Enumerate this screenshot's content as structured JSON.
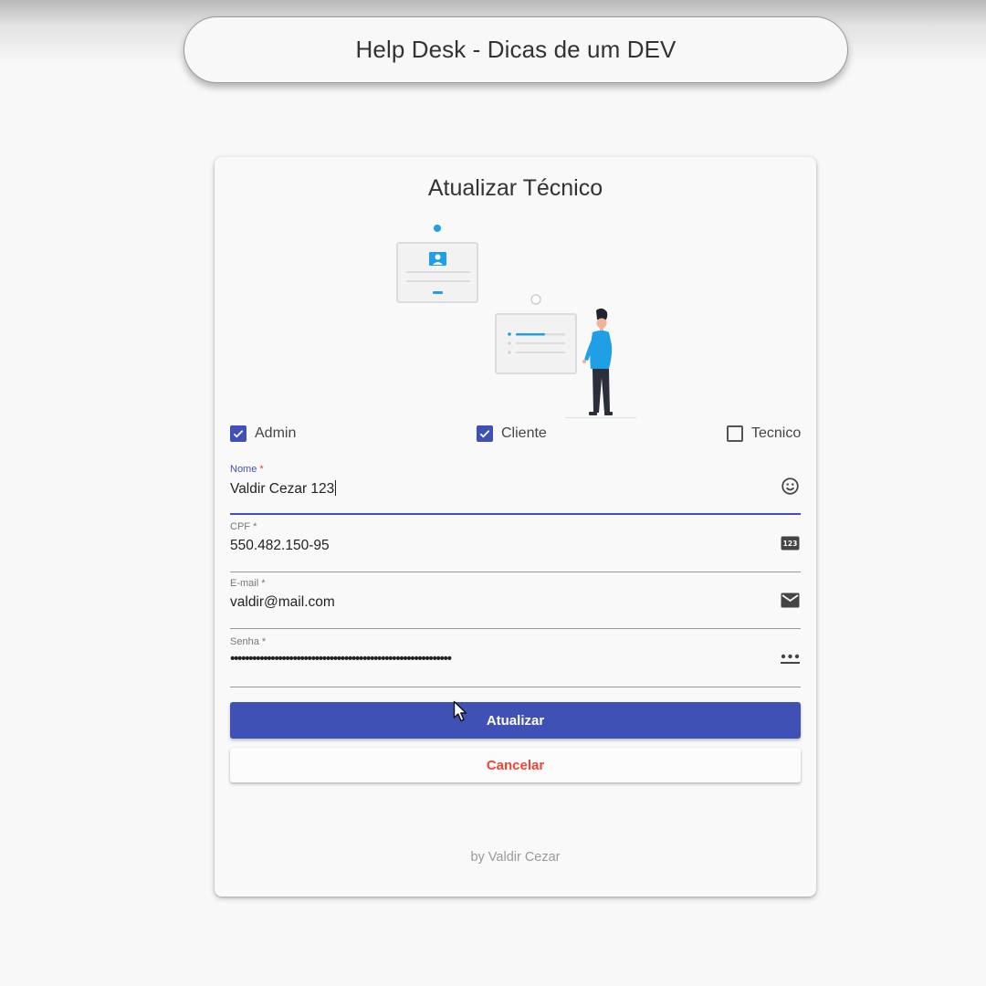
{
  "header": {
    "title": "Help Desk - Dicas de um DEV"
  },
  "form": {
    "title": "Atualizar Técnico",
    "roles": [
      {
        "label": "Admin",
        "checked": true
      },
      {
        "label": "Cliente",
        "checked": true
      },
      {
        "label": "Tecnico",
        "checked": false
      }
    ],
    "fields": {
      "nome": {
        "label": "Nome",
        "required_mark": "*",
        "value": "Valdir Cezar 123",
        "icon": "emoji-smile-icon"
      },
      "cpf": {
        "label": "CPF",
        "required_mark": "*",
        "value": "550.482.150-95",
        "icon": "numbers-123-icon"
      },
      "email": {
        "label": "E-mail",
        "required_mark": "*",
        "value": "valdir@mail.com",
        "icon": "mail-icon"
      },
      "senha": {
        "label": "Senha",
        "required_mark": "*",
        "value": "••••••••••••••••••••••••••••••••••••••••••••••••••••••••••••",
        "icon": "password-dots-icon"
      }
    },
    "submit_label": "Atualizar",
    "cancel_label": "Cancelar",
    "footer": "by Valdir Cezar"
  },
  "colors": {
    "primary": "#3f51b5",
    "warn": "#f44336",
    "illustration_accent": "#1e9fe6"
  }
}
